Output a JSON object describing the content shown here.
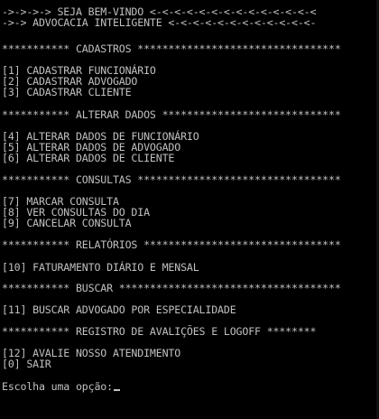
{
  "header": {
    "line1": "->->->-> SEJA BEM-VINDO <-<-<-<-<-<-<-<-<-<-<-<-<-<",
    "line2": "->-> ADVOCACIA INTELIGENTE <-<-<-<-<-<-<-<-<-<-<-<-"
  },
  "sections": {
    "cadastros": {
      "heading": "*********** CADASTROS *********************************",
      "items": [
        "[1] CADASTRAR FUNCIONÁRIO",
        "[2] CADASTRAR ADVOGADO",
        "[3] CADASTRAR CLIENTE"
      ]
    },
    "alterar": {
      "heading": "*********** ALTERAR DADOS *****************************",
      "items": [
        "[4] ALTERAR DADOS DE FUNCIONÁRIO",
        "[5] ALTERAR DADOS DE ADVOGADO",
        "[6] ALTERAR DADOS DE CLIENTE"
      ]
    },
    "consultas": {
      "heading": "*********** CONSULTAS *********************************",
      "items": [
        "[7] MARCAR CONSULTA",
        "[8] VER CONSULTAS DO DIA",
        "[9] CANCELAR CONSULTA"
      ]
    },
    "relatorios": {
      "heading": "*********** RELATÓRIOS ********************************",
      "items": [
        "[10] FATURAMENTO DIÁRIO E MENSAL"
      ]
    },
    "buscar": {
      "heading": "*********** BUSCAR ************************************",
      "items": [
        "[11] BUSCAR ADVOGADO POR ESPECIALIDADE"
      ]
    },
    "registro": {
      "heading": "*********** REGISTRO DE AVALIÇÕES E LOGOFF ********",
      "items": [
        "[12] AVALIE NOSSO ATENDIMENTO",
        "[0] SAIR"
      ]
    }
  },
  "prompt": {
    "text": "Escolha uma opção:"
  },
  "colors": {
    "background": "#000000",
    "text": "#c0c0c0"
  }
}
